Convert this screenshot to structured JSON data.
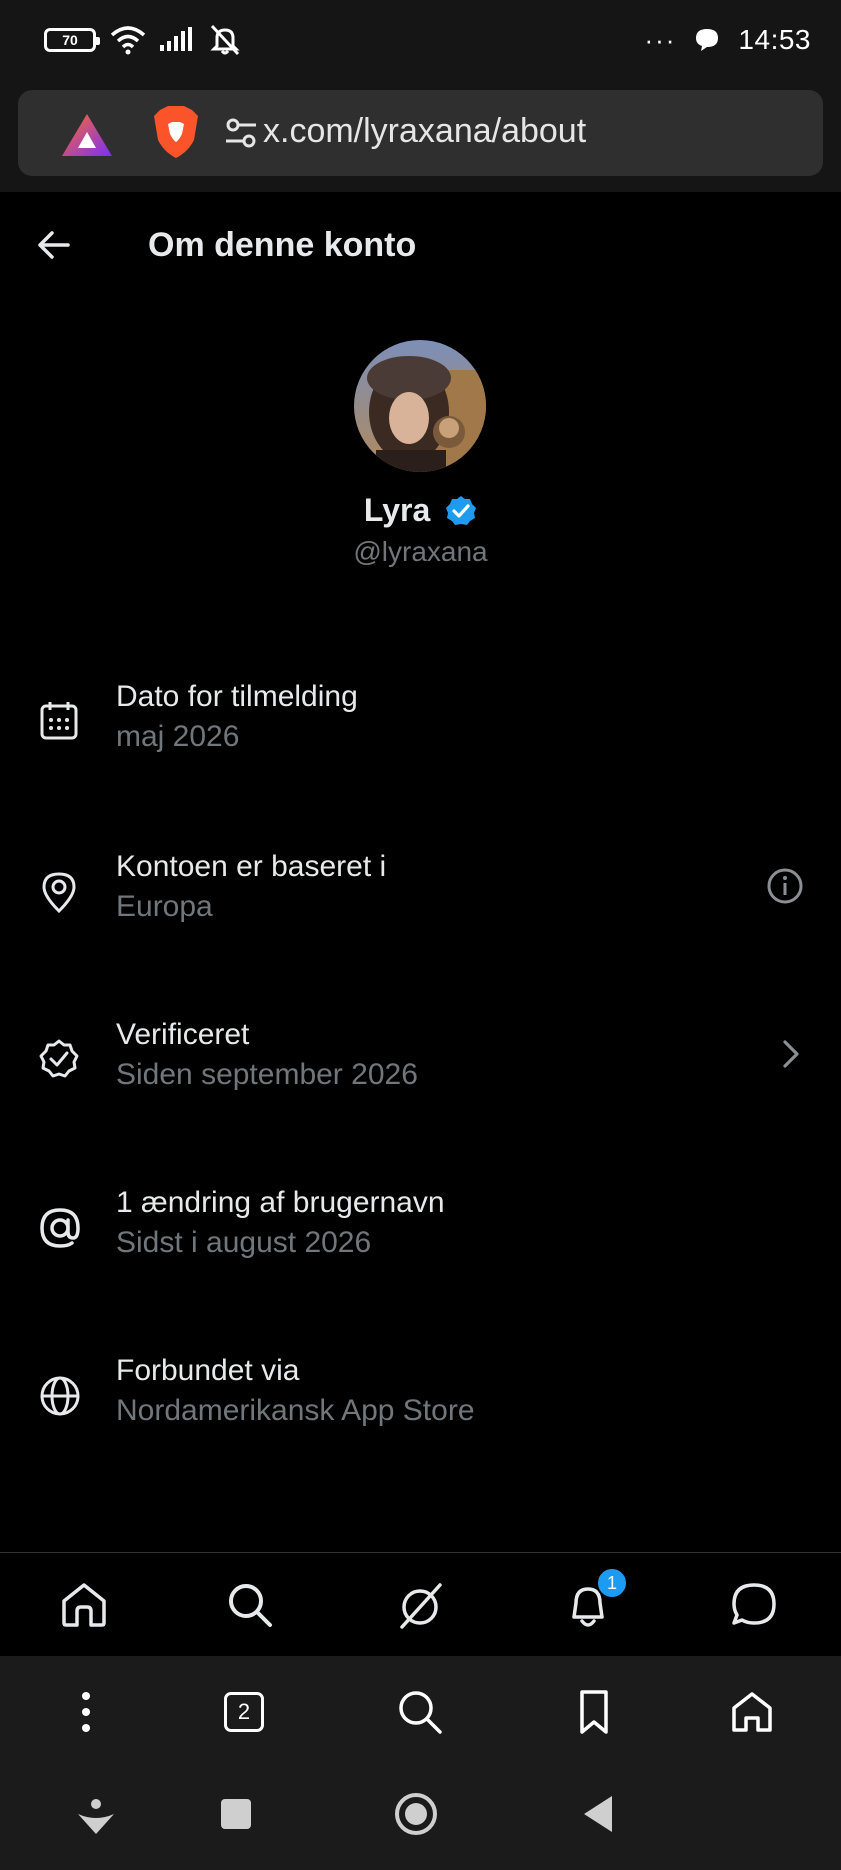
{
  "status_bar": {
    "battery": "70",
    "time": "14:53",
    "overflow": "···"
  },
  "browser": {
    "url": "x.com/lyraxana/about",
    "tab_count": "2"
  },
  "header": {
    "title": "Om denne konto"
  },
  "profile": {
    "name": "Lyra",
    "handle": "@lyraxana",
    "verified": true
  },
  "details": [
    {
      "icon": "calendar-icon",
      "title": "Dato for tilmelding",
      "value": "maj 2026"
    },
    {
      "icon": "location-pin-icon",
      "title": "Kontoen er baseret i",
      "value": "Europa"
    },
    {
      "icon": "verified-badge-icon",
      "title": "Verificeret",
      "value": "Siden september 2026"
    },
    {
      "icon": "at-sign-icon",
      "title": "1 ændring af brugernavn",
      "value": "Sidst i august 2026"
    },
    {
      "icon": "globe-icon",
      "title": "Forbundet via",
      "value": "Nordamerikansk App Store"
    }
  ],
  "tabbar": {
    "notification_count": "1"
  },
  "colors": {
    "background": "#000000",
    "text_primary": "#e7e9ea",
    "text_secondary": "#71767b",
    "accent": "#1d9bf0"
  }
}
